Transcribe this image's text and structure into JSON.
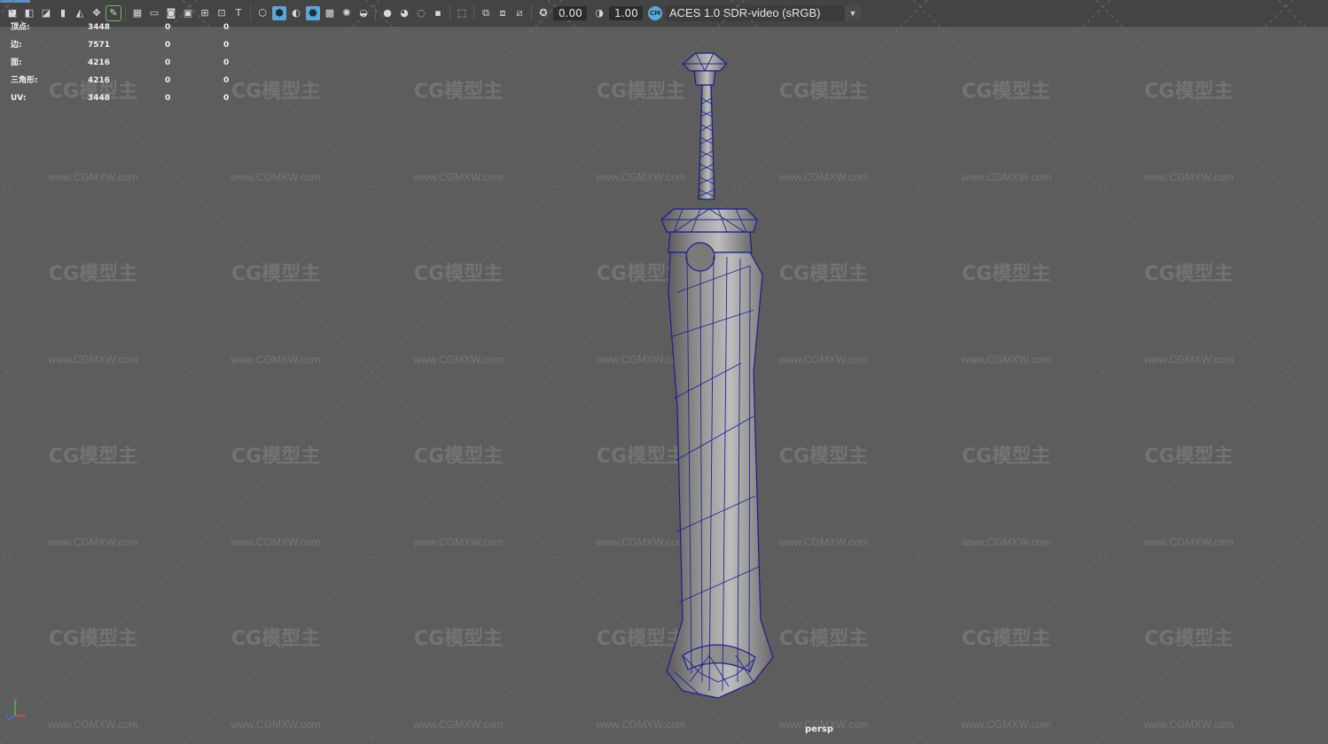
{
  "toolbar": {
    "exposure_value": "0.00",
    "gamma_value": "1.00",
    "color_management_badge": "CM",
    "color_space": "ACES 1.0 SDR-video (sRGB)",
    "icons": [
      "camera-icon",
      "camera-lock-icon",
      "camera-attr-icon",
      "bookmark-icon",
      "grid-snap-icon",
      "move-icon",
      "pencil-icon",
      "grid-icon",
      "film-gate-icon",
      "resolution-gate-icon",
      "gate-mask-icon",
      "field-chart-icon",
      "safe-action-icon",
      "safe-title-icon",
      "wireframe-icon",
      "smooth-shade-icon",
      "default-material-icon",
      "shaded-wireframe-icon",
      "textured-icon",
      "lights-icon",
      "shadows-icon",
      "ambient-occlusion-icon",
      "motion-blur-icon",
      "anti-alias-icon",
      "depth-of-field-icon",
      "isolate-icon",
      "xray-icon",
      "xray-joints-icon",
      "xray-components-icon",
      "exposure-icon",
      "gamma-icon",
      "color-management-icon"
    ],
    "accent_color": "#5aa8d8"
  },
  "stats": [
    {
      "label": "顶点:",
      "v1": "3448",
      "v2": "0",
      "v3": "0"
    },
    {
      "label": "边:",
      "v1": "7571",
      "v2": "0",
      "v3": "0"
    },
    {
      "label": "面:",
      "v1": "4216",
      "v2": "0",
      "v3": "0"
    },
    {
      "label": "三角形:",
      "v1": "4216",
      "v2": "0",
      "v3": "0"
    },
    {
      "label": "UV:",
      "v1": "3448",
      "v2": "0",
      "v3": "0"
    }
  ],
  "watermark": {
    "logo": "CG模型主",
    "url": "www.CGMXW.com"
  },
  "viewport": {
    "camera": "persp",
    "background_color": "#5d5d5d",
    "wire_color": "#1a1f8c",
    "axis": {
      "x": "x",
      "y": "y",
      "z": "z"
    }
  }
}
